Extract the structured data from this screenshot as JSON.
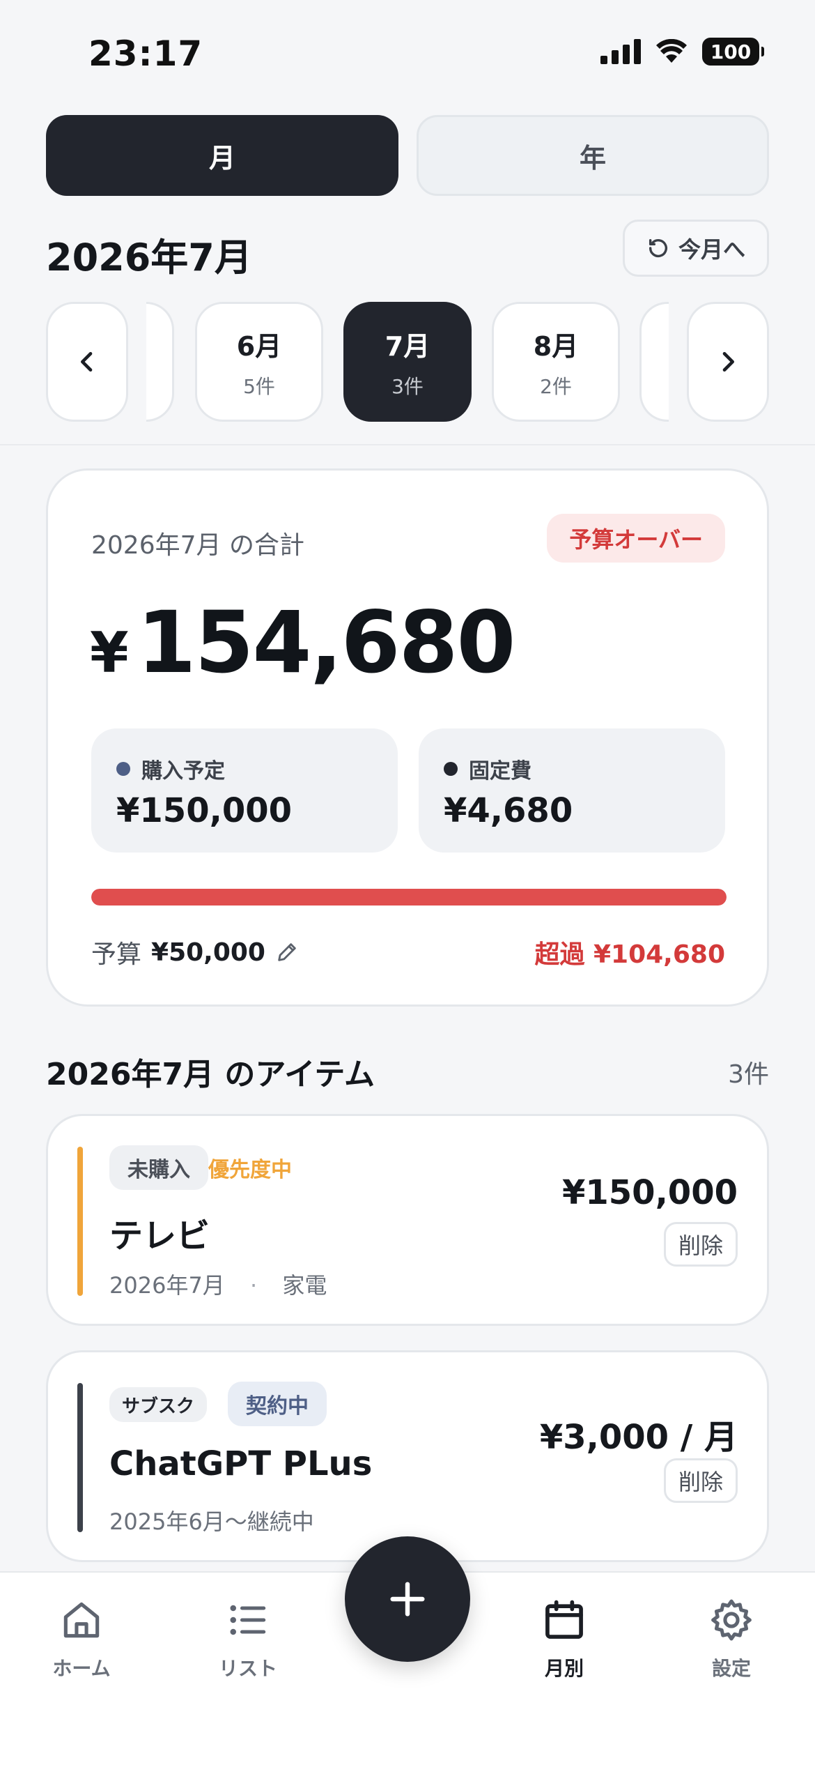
{
  "status": {
    "time": "23:17",
    "battery": "100"
  },
  "segment": {
    "month": "月",
    "year": "年"
  },
  "header": {
    "month_title": "2026年7月",
    "today_button": "今月へ"
  },
  "month_chips": [
    {
      "month": "6月",
      "count": "5件"
    },
    {
      "month": "7月",
      "count": "3件"
    },
    {
      "month": "8月",
      "count": "2件"
    }
  ],
  "summary": {
    "label": "2026年7月 の合計",
    "badge": "予算オーバー",
    "total_symbol": "¥",
    "total_value": "154,680",
    "planned_label": "購入予定",
    "planned_value": "¥150,000",
    "fixed_label": "固定費",
    "fixed_value": "¥4,680",
    "budget_label": "予算",
    "budget_value": "¥50,000",
    "excess": "超過 ¥104,680",
    "progress_fraction": 1.0
  },
  "items_section": {
    "title": "2026年7月 のアイテム",
    "count": "3件"
  },
  "items": [
    {
      "tag1": "未購入",
      "tag2": "優先度中",
      "name": "テレビ",
      "meta_date": "2026年7月",
      "meta_sep": "·",
      "meta_category": "家電",
      "price": "¥150,000",
      "delete": "削除"
    },
    {
      "tag1": "サブスク",
      "tag2": "契約中",
      "name": "ChatGPT PLus",
      "meta_date": "2025年6月〜継続中",
      "price": "¥3,000 / 月",
      "delete": "削除"
    }
  ],
  "tabbar": {
    "home": "ホーム",
    "list": "リスト",
    "monthly": "月別",
    "settings": "設定"
  },
  "colors": {
    "accent_dark": "#22252D",
    "over_red": "#D33A3A",
    "priority_orange": "#F0A53A",
    "planned_dot": "#4E5F86"
  }
}
